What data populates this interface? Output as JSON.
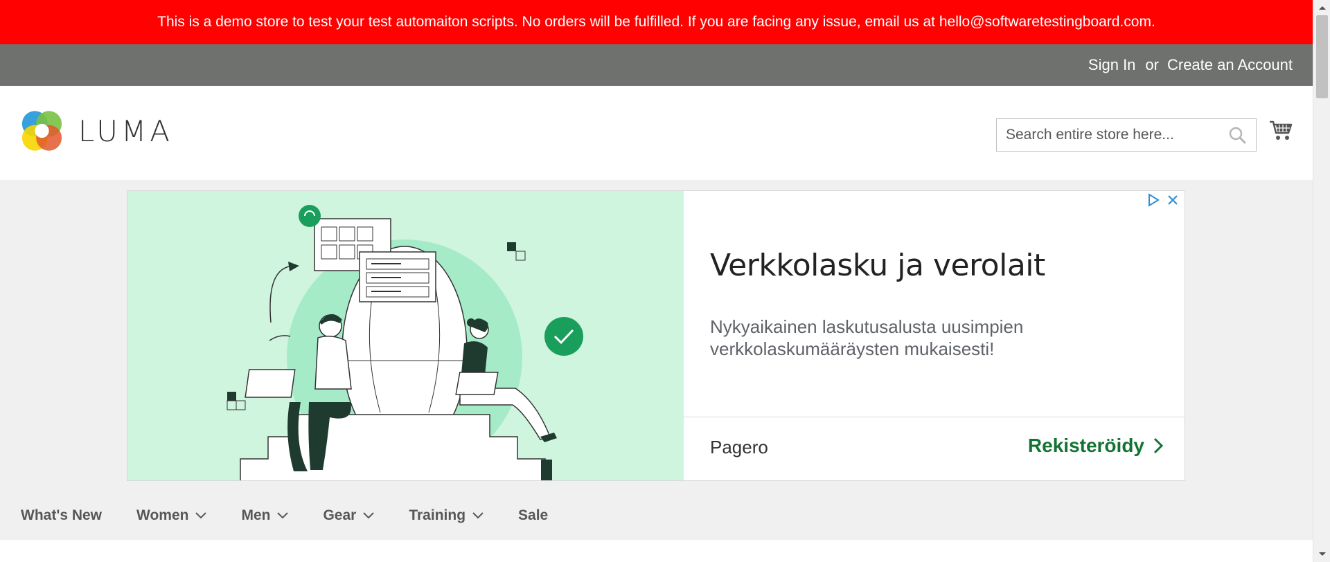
{
  "demo_banner": {
    "text": "This is a demo store to test your test automaiton scripts. No orders will be fulfilled. If you are facing any issue, email us at hello@softwaretestingboard.com."
  },
  "header": {
    "sign_in": "Sign In",
    "or": "or",
    "create_account": "Create an Account"
  },
  "logo": {
    "text": "LUMA",
    "icon": "luma-logo-icon"
  },
  "search": {
    "placeholder": "Search entire store here...",
    "value": "",
    "icon": "search-icon"
  },
  "cart": {
    "icon": "cart-icon"
  },
  "ad": {
    "title": "Verkkolasku ja verolait",
    "description": "Nykyaikainen laskutusalusta uusimpien verkkolaskumääräysten mukaisesti!",
    "advertiser": "Pagero",
    "cta": "Rekisteröidy",
    "illustration_bg": "#cff5df",
    "accent_green": "#1a9e5c",
    "cta_color": "#137333"
  },
  "nav": {
    "items": [
      {
        "label": "What's New",
        "has_dropdown": false
      },
      {
        "label": "Women",
        "has_dropdown": true
      },
      {
        "label": "Men",
        "has_dropdown": true
      },
      {
        "label": "Gear",
        "has_dropdown": true
      },
      {
        "label": "Training",
        "has_dropdown": true
      },
      {
        "label": "Sale",
        "has_dropdown": false
      }
    ]
  },
  "colors": {
    "banner_red": "#ff0101",
    "header_gray": "#6e716e",
    "nav_bg": "#f0f0f0"
  }
}
